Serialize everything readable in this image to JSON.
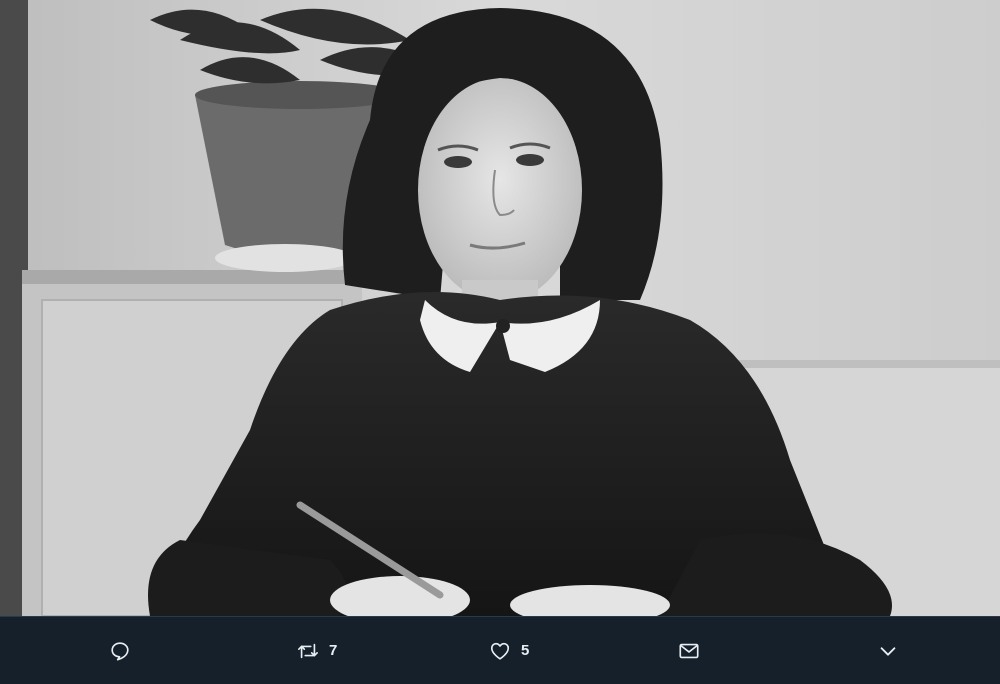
{
  "media": {
    "alt_kind": "black-and-white portrait photo"
  },
  "actions": {
    "reply": {
      "icon": "reply-icon"
    },
    "retweet": {
      "icon": "retweet-icon",
      "count": "7"
    },
    "like": {
      "icon": "heart-icon",
      "count": "5"
    },
    "dm": {
      "icon": "envelope-icon"
    },
    "more": {
      "icon": "chevron-down-icon"
    }
  },
  "colors": {
    "bar_background": "#15202b",
    "icon_color": "#e9eef3"
  }
}
